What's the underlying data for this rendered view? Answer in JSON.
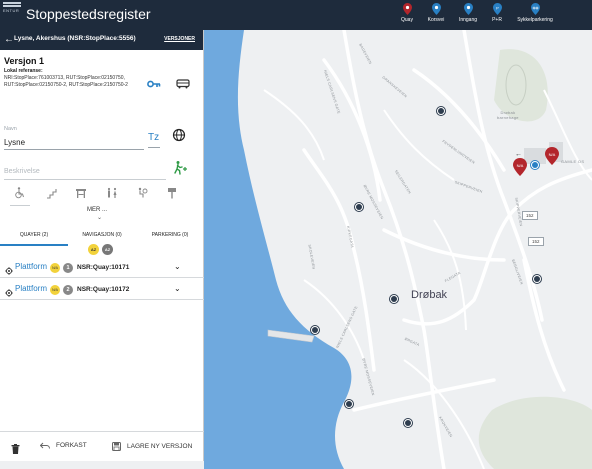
{
  "app": {
    "logo_text": "ENTUR",
    "title": "Stoppestedsregister"
  },
  "legend": [
    {
      "label": "Quay",
      "color": "#b3262c"
    },
    {
      "label": "Korsvei",
      "color": "#2980c4"
    },
    {
      "label": "Inngang",
      "color": "#2980c4"
    },
    {
      "label": "P+R",
      "color": "#2980c4"
    },
    {
      "label": "Sykkelparkering",
      "color": "#2980c4"
    }
  ],
  "panel": {
    "header_title": "Lysne, Akershus (NSR:StopPlace:5556)",
    "versions_label": "VERSJONER",
    "version_title": "Versjon 1",
    "local_ref_label": "Lokal referanse:",
    "local_ref_text": "NRI:StopPlace:761003713, RUT:StopPlace:02150750, RUT:StopPlace:02150750-2, RUT:StopPlace:2150750-2",
    "name_label": "Navn",
    "name_value": "Lysne",
    "tz_label": "Tz",
    "description_placeholder": "Beskrivelse",
    "more_label": "MER ...",
    "tabs": [
      {
        "label": "QUAYER (2)",
        "active": true
      },
      {
        "label": "NAVIGASJON (0)",
        "active": false
      },
      {
        "label": "PARKERING (0)",
        "active": false
      }
    ],
    "sort_buttons": [
      "AZ",
      "AZ"
    ],
    "quays": [
      {
        "label": "Plattform",
        "badge": "N/A",
        "number": "1",
        "id": "NSR:Quay:10171"
      },
      {
        "label": "Plattform",
        "badge": "N/A",
        "number": "2",
        "id": "NSR:Quay:10172"
      }
    ],
    "footer": {
      "discard_label": "FORKAST",
      "save_label": "LAGRE NY VERSJON"
    }
  },
  "map": {
    "city": "Drøbak",
    "road_numbers": [
      "152",
      "152"
    ],
    "selected_pins": [
      "N/A",
      "N/A"
    ],
    "place_labels": [
      "Drøbak\nbarnehage",
      "GAMLE OS"
    ],
    "street_labels": [
      "BADEVEIEN",
      "NIELS CARLSENS GATE",
      "GRANSKEVEIEN",
      "FRYDENLUNDVEIEN",
      "SEILERGATEN",
      "SKIPPERVEIEN",
      "KIRKEGATA",
      "ØVRE MOSSEVEIEN",
      "SKOLEVEIEN",
      "BERGLIVEIEN",
      "FLEGATA",
      "ØRGATA",
      "NIELS CARLSENS GATE",
      "ØVRE MOSSEVEIEN",
      "KROKVEIEN",
      "SKIPPERVEIEN"
    ]
  }
}
